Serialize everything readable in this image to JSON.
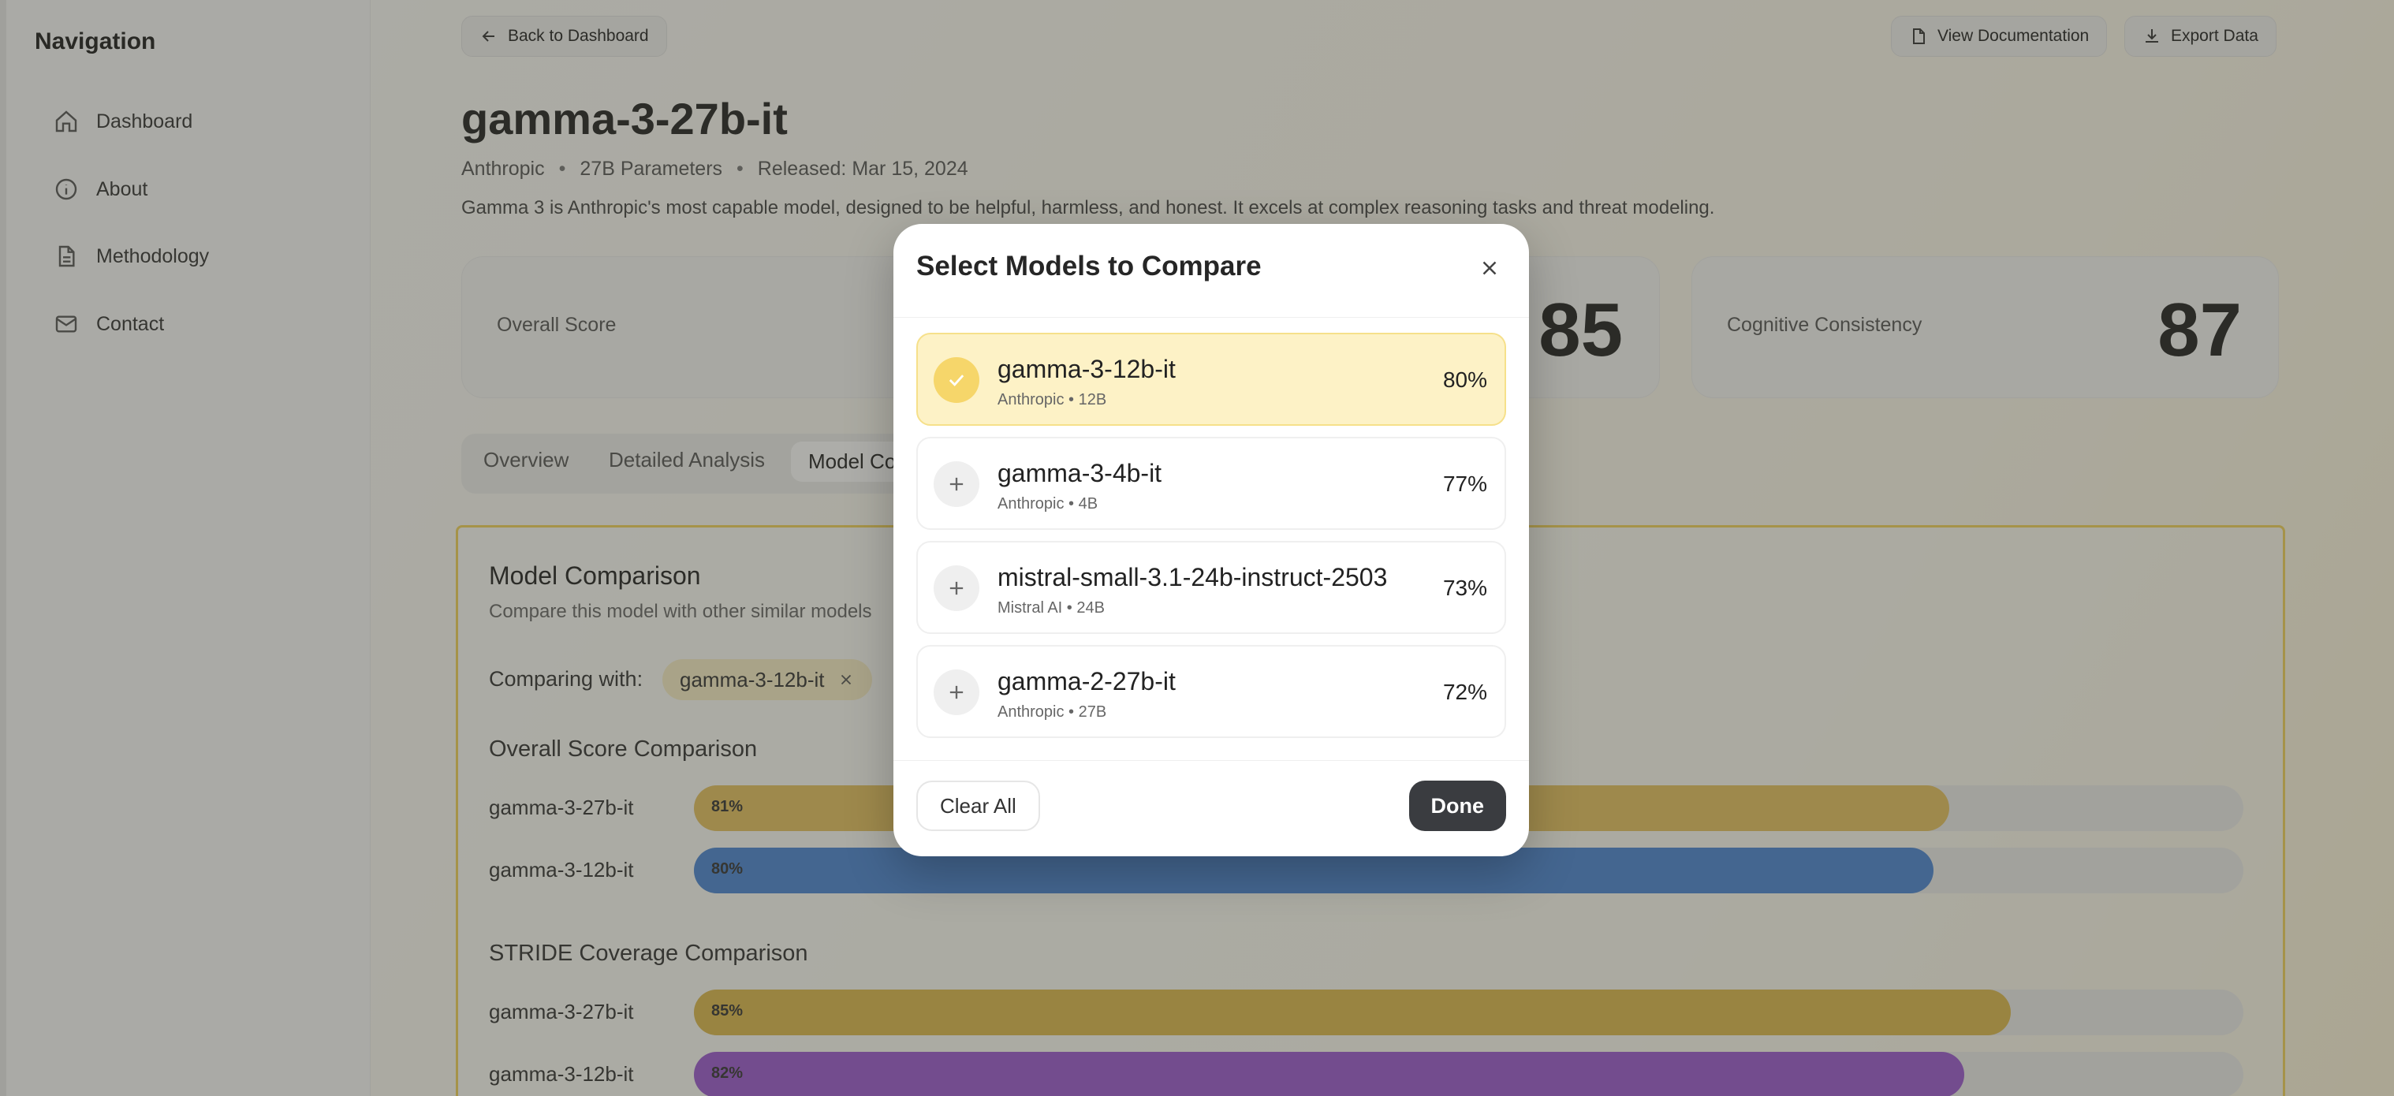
{
  "sidebar": {
    "title": "Navigation",
    "items": [
      {
        "label": "Dashboard",
        "icon": "home-icon"
      },
      {
        "label": "About",
        "icon": "info-icon"
      },
      {
        "label": "Methodology",
        "icon": "document-icon"
      },
      {
        "label": "Contact",
        "icon": "mail-icon"
      }
    ]
  },
  "header": {
    "back_label": "Back to Dashboard",
    "docs_label": "View Documentation",
    "export_label": "Export Data"
  },
  "model": {
    "name": "gamma-3-27b-it",
    "provider": "Anthropic",
    "params": "27B Parameters",
    "released": "Released: Mar 15, 2024",
    "description": "Gamma 3 is Anthropic's most capable model, designed to be helpful, harmless, and honest. It excels at complex reasoning tasks and threat modeling."
  },
  "scores": {
    "overall_label": "Overall Score",
    "middle_value": "85",
    "consistency_label": "Cognitive Consistency",
    "consistency_value": "87"
  },
  "tabs": [
    "Overview",
    "Detailed Analysis",
    "Model Co"
  ],
  "comparison": {
    "title": "Model Comparison",
    "subtitle": "Compare this model with other similar models",
    "comparing_label": "Comparing with:",
    "chip_label": "gamma-3-12b-it",
    "overall_title": "Overall Score Comparison",
    "overall_bars": [
      {
        "label": "gamma-3-27b-it",
        "value": 81,
        "text": "81%",
        "color": "#e6c260"
      },
      {
        "label": "gamma-3-12b-it",
        "value": 80,
        "text": "80%",
        "color": "#4a86d4"
      }
    ],
    "stride_title": "STRIDE Coverage Comparison",
    "stride_bars": [
      {
        "label": "gamma-3-27b-it",
        "value": 85,
        "text": "85%",
        "color": "#dcb84d"
      },
      {
        "label": "gamma-3-12b-it",
        "value": 82,
        "text": "82%",
        "color": "#9b59d0"
      }
    ]
  },
  "modal": {
    "title": "Select Models to Compare",
    "models": [
      {
        "name": "gamma-3-12b-it",
        "sub": "Anthropic • 12B",
        "pct": "80%",
        "selected": true
      },
      {
        "name": "gamma-3-4b-it",
        "sub": "Anthropic • 4B",
        "pct": "77%",
        "selected": false
      },
      {
        "name": "mistral-small-3.1-24b-instruct-2503",
        "sub": "Mistral AI • 24B",
        "pct": "73%",
        "selected": false
      },
      {
        "name": "gamma-2-27b-it",
        "sub": "Anthropic • 27B",
        "pct": "72%",
        "selected": false
      }
    ],
    "clear_label": "Clear All",
    "done_label": "Done"
  }
}
